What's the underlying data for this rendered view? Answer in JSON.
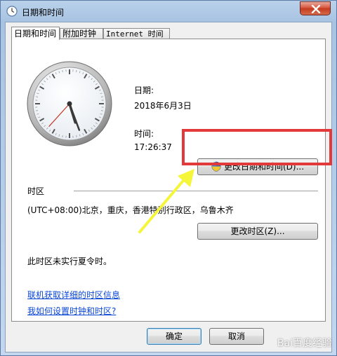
{
  "window": {
    "title": "日期和时间",
    "close_icon": "close-icon"
  },
  "tabs": [
    {
      "label": "日期和时间",
      "active": true
    },
    {
      "label": "附加时钟",
      "active": false
    },
    {
      "label": "Internet 时间",
      "active": false
    }
  ],
  "datetime": {
    "date_label": "日期:",
    "date_value": "2018年6月3日",
    "time_label": "时间:",
    "time_value": "17:26:37",
    "change_datetime_button": "更改日期和时间(D)...",
    "clock_time": {
      "hour": 17,
      "minute": 26,
      "second": 37
    }
  },
  "timezone": {
    "section_label": "时区",
    "value": "(UTC+08:00)北京，重庆，香港特别行政区，乌鲁木齐",
    "change_timezone_button": "更改时区(Z)...",
    "dst_note": "此时区未实行夏令时。"
  },
  "links": {
    "online_info": "联机获取详细的时区信息",
    "how_to_set": "我如何设置时钟和时区?"
  },
  "footer": {
    "ok_button": "确定",
    "cancel_button": "取消"
  },
  "annotation": {
    "highlight_color": "#e23a3a",
    "arrow_color": "#f5f53a"
  },
  "watermark": "Bai百度经验"
}
